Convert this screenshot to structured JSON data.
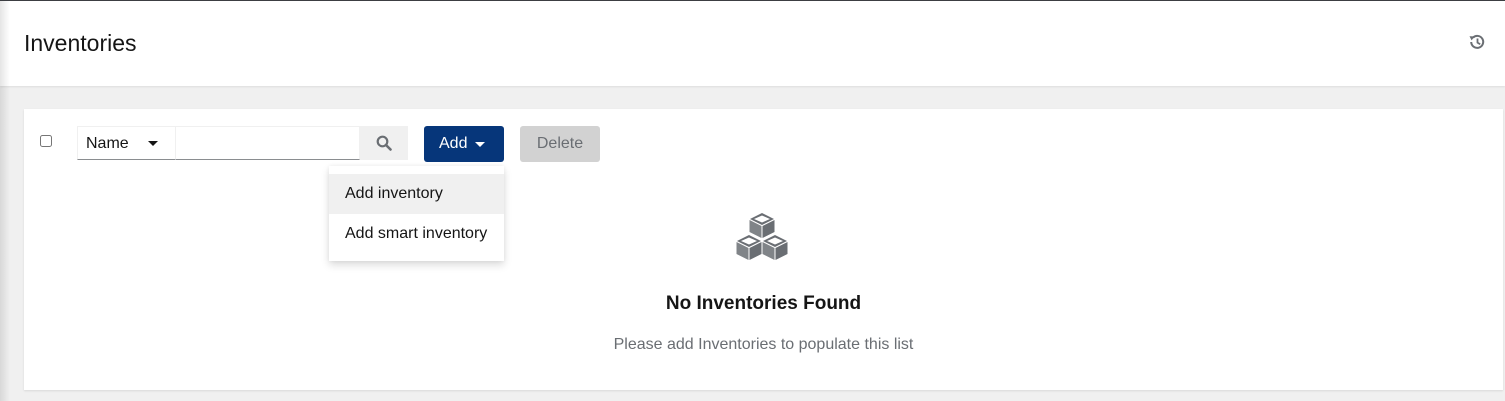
{
  "header": {
    "title": "Inventories",
    "history_icon": "history-icon"
  },
  "toolbar": {
    "select_all_checked": false,
    "filter_select_value": "Name",
    "search_value": "",
    "search_icon": "search-icon",
    "add_label": "Add",
    "delete_label": "Delete"
  },
  "add_dropdown": {
    "items": [
      {
        "label": "Add inventory"
      },
      {
        "label": "Add smart inventory"
      }
    ]
  },
  "empty_state": {
    "icon": "cubes-icon",
    "title": "No Inventories Found",
    "body": "Please add Inventories to populate this list"
  },
  "colors": {
    "primary": "#06367a",
    "disabled_button": "#d2d2d2",
    "background": "#f0f0f0",
    "icon_gray": "#6a6e73"
  }
}
